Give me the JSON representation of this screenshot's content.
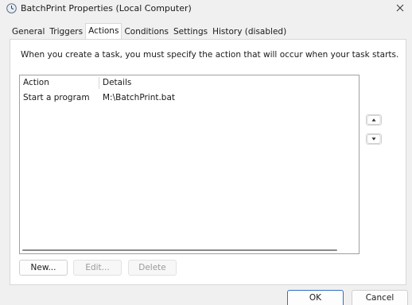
{
  "window": {
    "title": "BatchPrint Properties (Local Computer)",
    "app_icon": "clock-icon",
    "close_icon": "close-icon"
  },
  "tabs": [
    {
      "label": "General",
      "active": false
    },
    {
      "label": "Triggers",
      "active": false
    },
    {
      "label": "Actions",
      "active": true
    },
    {
      "label": "Conditions",
      "active": false
    },
    {
      "label": "Settings",
      "active": false
    },
    {
      "label": "History (disabled)",
      "active": false
    }
  ],
  "actions_panel": {
    "instruction": "When you create a task, you must specify the action that will occur when your task starts.",
    "columns": {
      "action": "Action",
      "details": "Details"
    },
    "rows": [
      {
        "action": "Start a program",
        "details": "M:\\BatchPrint.bat"
      }
    ],
    "move_up_icon": "triangle-up-icon",
    "move_down_icon": "triangle-down-icon",
    "buttons": {
      "new": "New...",
      "edit": "Edit...",
      "delete": "Delete"
    }
  },
  "dialog_buttons": {
    "ok": "OK",
    "cancel": "Cancel"
  },
  "colors": {
    "background": "#f0f0f0",
    "panel": "#ffffff",
    "accent": "#2f6fc6"
  }
}
